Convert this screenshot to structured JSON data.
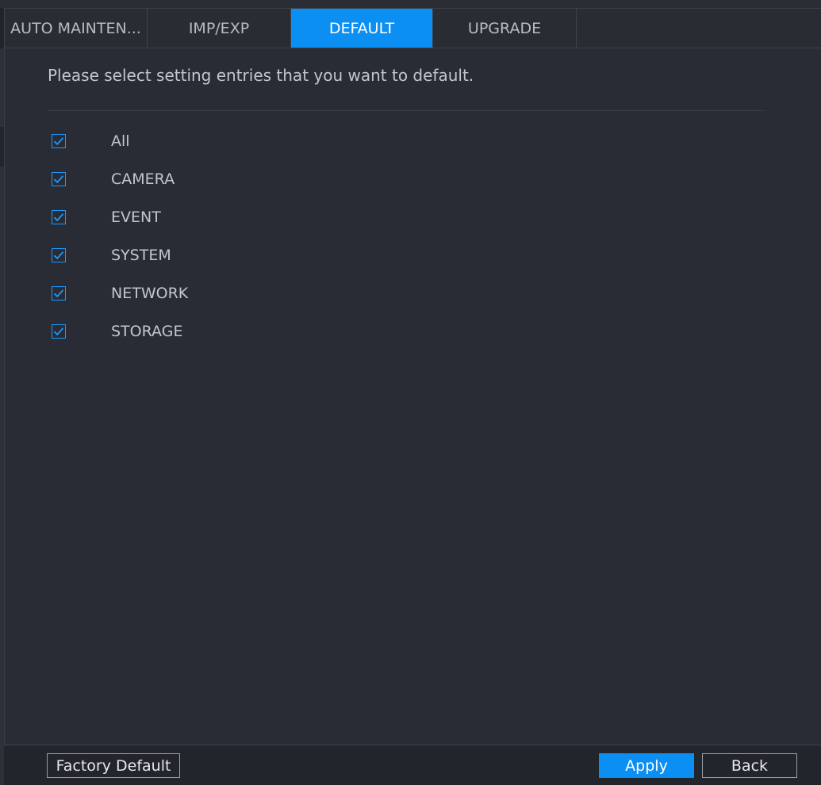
{
  "tabs": [
    {
      "label": "AUTO MAINTEN...",
      "active": false
    },
    {
      "label": "IMP/EXP",
      "active": false
    },
    {
      "label": "DEFAULT",
      "active": true
    },
    {
      "label": "UPGRADE",
      "active": false
    }
  ],
  "main": {
    "instruction": "Please select setting entries that you want to default.",
    "options": [
      {
        "label": "All",
        "checked": true
      },
      {
        "label": "CAMERA",
        "checked": true
      },
      {
        "label": "EVENT",
        "checked": true
      },
      {
        "label": "SYSTEM",
        "checked": true
      },
      {
        "label": "NETWORK",
        "checked": true
      },
      {
        "label": "STORAGE",
        "checked": true
      }
    ]
  },
  "footer": {
    "factory_default_label": "Factory Default",
    "apply_label": "Apply",
    "back_label": "Back"
  },
  "colors": {
    "accent": "#0c8ff2",
    "background": "#22242c",
    "panel": "#2a2c35",
    "text": "#c3c6cd"
  },
  "icons": {
    "checkbox": "checkmark-icon"
  }
}
